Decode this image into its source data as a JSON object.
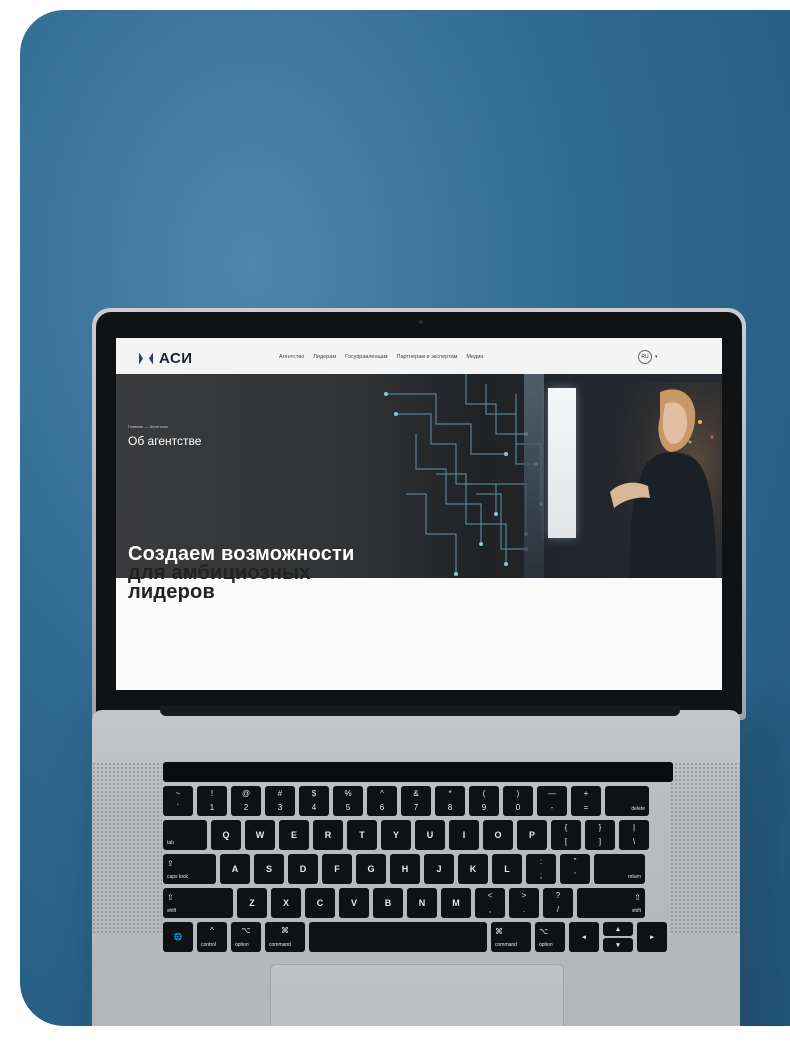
{
  "website": {
    "logo_text": "АСИ",
    "nav_items": [
      "Агентство",
      "Лидерам",
      "Госуправленцам",
      "Партнерам и экспертам",
      "Медиа"
    ],
    "lang": "RU",
    "lang_caret": "▾",
    "breadcrumb": "Главная — Агентство",
    "hero_title": "Об агентстве",
    "headline": [
      "Создаем возможности",
      "для амбициозных",
      "лидеров"
    ],
    "colors": {
      "logo": "#27398f",
      "hero_bg": "#303234"
    }
  },
  "keyboard": {
    "row1": [
      [
        "~",
        "`"
      ],
      [
        "!",
        "1"
      ],
      [
        "@",
        "2"
      ],
      [
        "#",
        "3"
      ],
      [
        "$",
        "4"
      ],
      [
        "%",
        "5"
      ],
      [
        "^",
        "6"
      ],
      [
        "&",
        "7"
      ],
      [
        "*",
        "8"
      ],
      [
        "(",
        "9"
      ],
      [
        ")",
        "0"
      ],
      [
        "—",
        "-"
      ],
      [
        "+",
        "="
      ]
    ],
    "delete": "delete",
    "tab": "tab",
    "row2": [
      "Q",
      "W",
      "E",
      "R",
      "T",
      "Y",
      "U",
      "I",
      "O",
      "P"
    ],
    "row2_sym": [
      [
        "{",
        "["
      ],
      [
        "}",
        "]"
      ],
      [
        "|",
        "\\"
      ]
    ],
    "caps_icon": "⇪",
    "caps": "caps lock",
    "row3": [
      "A",
      "S",
      "D",
      "F",
      "G",
      "H",
      "J",
      "K",
      "L"
    ],
    "row3_sym": [
      [
        ":",
        ";"
      ],
      [
        "\"",
        "'"
      ]
    ],
    "return": "return",
    "shift_icon": "⇧",
    "shift": "shift",
    "row4": [
      "Z",
      "X",
      "C",
      "V",
      "B",
      "N",
      "M"
    ],
    "row4_sym": [
      [
        "<",
        ","
      ],
      [
        ">",
        "."
      ],
      [
        "?",
        "/"
      ]
    ],
    "globe_icon": "🌐",
    "control": "control",
    "control_icon": "^",
    "option": "option",
    "option_icon": "⌥",
    "command": "command",
    "command_icon": "⌘",
    "arrows": {
      "left": "◂",
      "up": "▴",
      "down": "▾",
      "right": "▸"
    }
  }
}
